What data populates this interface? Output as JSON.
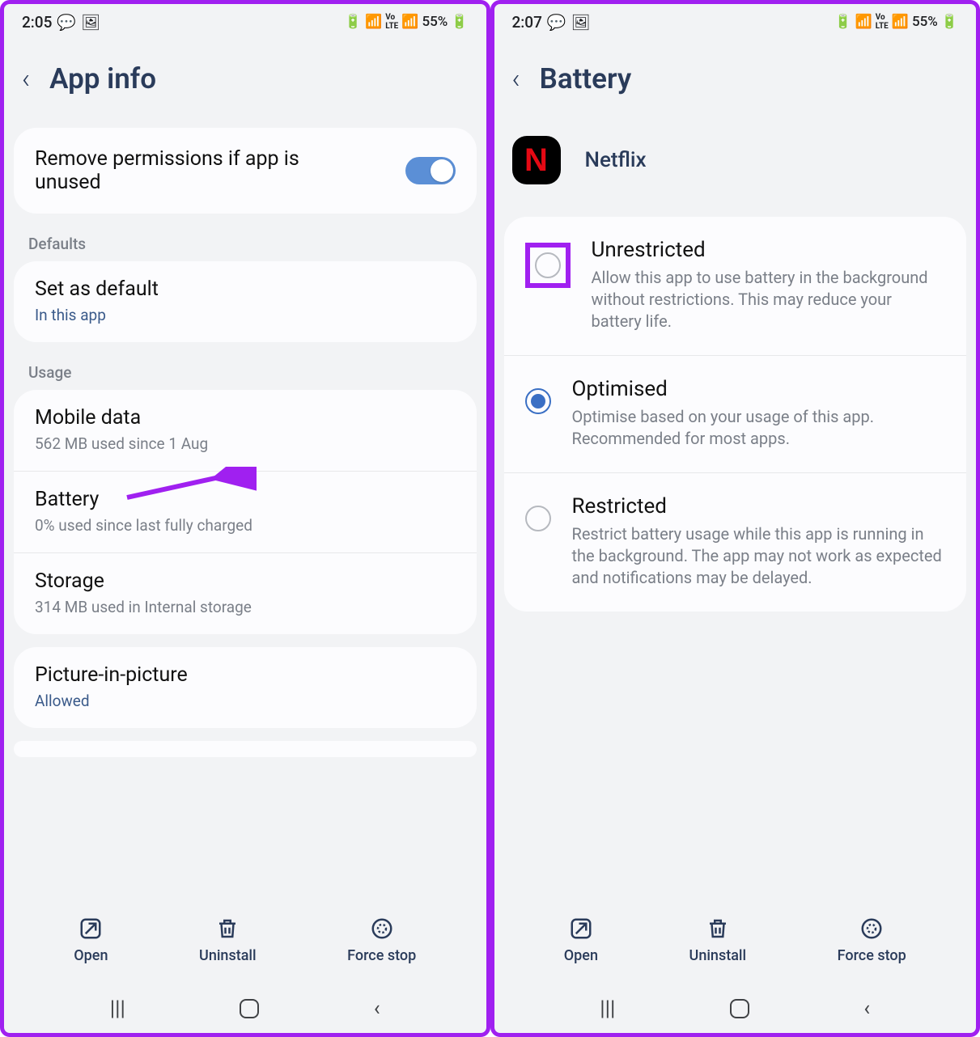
{
  "left": {
    "statusbar": {
      "time": "2:05",
      "battery_pct": "55%"
    },
    "header": {
      "title": "App info"
    },
    "permissions": {
      "label": "Remove permissions if app is unused",
      "toggled": true
    },
    "section_defaults": "Defaults",
    "defaults_row": {
      "title": "Set as default",
      "sub": "In this app"
    },
    "section_usage": "Usage",
    "mobile_data": {
      "title": "Mobile data",
      "sub": "562 MB used since 1 Aug"
    },
    "battery": {
      "title": "Battery",
      "sub": "0% used since last fully charged"
    },
    "storage": {
      "title": "Storage",
      "sub": "314 MB used in Internal storage"
    },
    "pip": {
      "title": "Picture-in-picture",
      "sub": "Allowed"
    },
    "actions": {
      "open": "Open",
      "uninstall": "Uninstall",
      "forcestop": "Force stop"
    }
  },
  "right": {
    "statusbar": {
      "time": "2:07",
      "battery_pct": "55%"
    },
    "header": {
      "title": "Battery"
    },
    "app": {
      "name": "Netflix",
      "glyph": "N"
    },
    "options": {
      "unrestricted": {
        "title": "Unrestricted",
        "desc": "Allow this app to use battery in the background without restrictions. This may reduce your battery life."
      },
      "optimised": {
        "title": "Optimised",
        "desc": "Optimise based on your usage of this app. Recommended for most apps."
      },
      "restricted": {
        "title": "Restricted",
        "desc": "Restrict battery usage while this app is running in the background. The app may not work as expected and notifications may be delayed."
      }
    },
    "selected": "optimised",
    "actions": {
      "open": "Open",
      "uninstall": "Uninstall",
      "forcestop": "Force stop"
    }
  }
}
